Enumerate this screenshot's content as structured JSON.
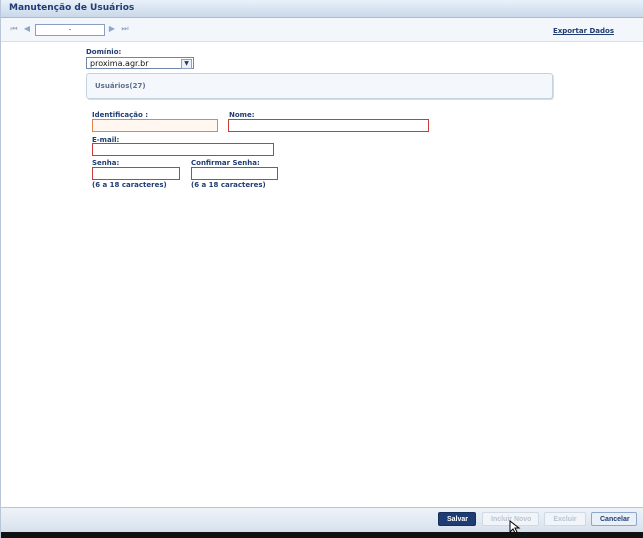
{
  "window": {
    "title": "Manutenção de Usuários"
  },
  "navigation": {
    "record_value": "-",
    "export_label": "Exportar Dados",
    "icons": [
      "first-icon",
      "previous-icon",
      "next-icon",
      "last-icon"
    ]
  },
  "form": {
    "domain_label": "Domínio:",
    "domain_value": "proxima.agr.br",
    "users_panel_title": "Usuários(27)",
    "identification_label": "Identificação :",
    "name_label": "Nome:",
    "email_label": "E-mail:",
    "password_label": "Senha:",
    "confirm_password_label": "Confirmar Senha:",
    "password_hint": "(6 a 18 caracteres)",
    "confirm_password_hint": "(6 a 18 caracteres)"
  },
  "actions": {
    "save_label": "Salvar",
    "include_new_label": "Incluir Novo",
    "delete_label": "Excluir",
    "cancel_label": "Cancelar"
  },
  "colors": {
    "accent": "#1f3d72",
    "required_border": "#cc3b3b",
    "focused_border": "#e08550"
  }
}
